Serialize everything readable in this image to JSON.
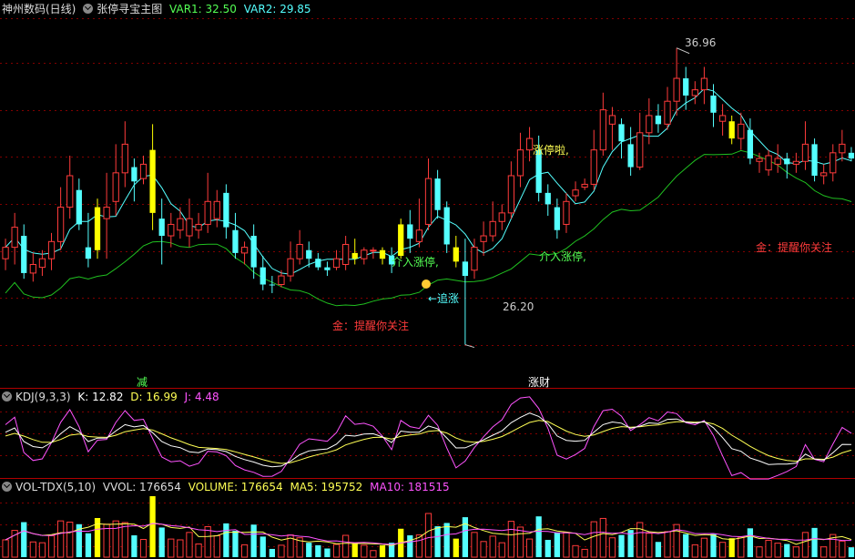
{
  "main": {
    "title": "神州数码(日线)",
    "indicator": "张停寻宝主图",
    "var1": "VAR1: 32.50",
    "var2": "VAR2: 29.85",
    "high_label": "36.96",
    "low_label": "26.20",
    "annotations": {
      "zhangtingla": "涨停啦,",
      "jieru1": "介入涨停,",
      "jieru2": "介入涨停,",
      "zhuizhang": "←追涨",
      "jin1": "金：提醒你关注",
      "jin2": "金：提醒你关注",
      "jian": "减",
      "zhangcai": "涨财"
    },
    "colors": {
      "up": "#ff3b3b",
      "down": "#54ffff",
      "signal": "#ffff00",
      "ma_fast": "#54ffff",
      "ma_slow": "#20c020"
    }
  },
  "kdj": {
    "label": "KDJ(9,3,3)",
    "k": "K: 12.82",
    "d": "D: 16.99",
    "j": "J: 4.48"
  },
  "vol": {
    "label": "VOL-TDX(5,10)",
    "vvol": "VVOL: 176654",
    "volume": "VOLUME: 176654",
    "ma5": "MA5: 195752",
    "ma10": "MA10: 181515"
  },
  "chart_data": [
    {
      "type": "candlestick",
      "title": "神州数码(日线)",
      "series": [
        {
          "name": "VAR1",
          "last": 32.5
        },
        {
          "name": "VAR2",
          "last": 29.85
        }
      ],
      "candles": [
        [
          29.6,
          30.0,
          29.2,
          30.3,
          "u"
        ],
        [
          30.0,
          30.7,
          29.4,
          31.2,
          "u"
        ],
        [
          30.4,
          29.1,
          28.9,
          30.8,
          "d"
        ],
        [
          29.1,
          29.4,
          28.8,
          29.8,
          "u"
        ],
        [
          29.3,
          29.6,
          29.0,
          29.9,
          "u"
        ],
        [
          29.6,
          30.2,
          29.2,
          30.5,
          "u"
        ],
        [
          30.2,
          31.4,
          29.9,
          32.1,
          "u"
        ],
        [
          31.4,
          32.5,
          31.0,
          33.2,
          "u"
        ],
        [
          32.0,
          30.8,
          30.6,
          32.4,
          "d"
        ],
        [
          30.0,
          29.6,
          29.3,
          31.2,
          "d"
        ],
        [
          29.9,
          31.4,
          29.6,
          31.7,
          "s"
        ],
        [
          31.4,
          31.0,
          29.6,
          32.6,
          "u"
        ],
        [
          31.6,
          32.6,
          31.1,
          33.6,
          "u"
        ],
        [
          32.6,
          33.6,
          32.1,
          34.4,
          "u"
        ],
        [
          32.8,
          32.3,
          31.6,
          33.1,
          "d"
        ],
        [
          32.4,
          32.9,
          32.2,
          33.2,
          "u"
        ],
        [
          33.4,
          31.2,
          30.6,
          34.3,
          "s"
        ],
        [
          31.0,
          30.4,
          29.4,
          31.7,
          "d"
        ],
        [
          30.4,
          30.8,
          30.0,
          31.2,
          "u"
        ],
        [
          30.6,
          31.0,
          30.3,
          31.4,
          "u"
        ],
        [
          31.0,
          30.4,
          30.0,
          31.7,
          "u"
        ],
        [
          30.6,
          30.8,
          30.3,
          31.2,
          "u"
        ],
        [
          30.8,
          31.6,
          30.5,
          32.6,
          "u"
        ],
        [
          31.6,
          31.0,
          30.7,
          32.0,
          "u"
        ],
        [
          31.9,
          30.7,
          30.3,
          32.2,
          "d"
        ],
        [
          30.6,
          29.8,
          29.6,
          31.2,
          "d"
        ],
        [
          30.0,
          29.8,
          29.4,
          30.2,
          "u"
        ],
        [
          30.4,
          29.3,
          28.9,
          30.8,
          "d"
        ],
        [
          29.3,
          28.7,
          28.5,
          29.7,
          "d"
        ],
        [
          28.7,
          28.7,
          28.4,
          29.0,
          "d"
        ],
        [
          28.7,
          29.0,
          28.6,
          29.2,
          "u"
        ],
        [
          29.0,
          29.6,
          28.8,
          30.2,
          "u"
        ],
        [
          29.6,
          30.1,
          29.4,
          30.6,
          "u"
        ],
        [
          29.9,
          29.6,
          29.3,
          30.2,
          "d"
        ],
        [
          29.6,
          29.3,
          29.2,
          29.8,
          "d"
        ],
        [
          29.2,
          29.3,
          29.0,
          29.5,
          "d"
        ],
        [
          29.3,
          29.6,
          29.2,
          29.9,
          "u"
        ],
        [
          29.4,
          30.1,
          29.2,
          30.4,
          "u"
        ],
        [
          29.8,
          29.6,
          29.4,
          30.3,
          "s"
        ],
        [
          29.6,
          29.9,
          29.4,
          30.0,
          "u"
        ],
        [
          29.9,
          29.9,
          29.6,
          30.0,
          "u"
        ],
        [
          29.9,
          29.6,
          29.4,
          30.0,
          "s"
        ],
        [
          29.7,
          29.4,
          29.1,
          30.0,
          "d"
        ],
        [
          29.7,
          30.8,
          29.6,
          31.0,
          "s"
        ],
        [
          30.8,
          30.3,
          29.8,
          31.3,
          "d"
        ],
        [
          30.2,
          30.6,
          30.0,
          31.7,
          "u"
        ],
        [
          30.8,
          32.4,
          30.6,
          33.1,
          "u"
        ],
        [
          32.4,
          31.3,
          31.0,
          32.7,
          "d"
        ],
        [
          31.4,
          30.1,
          29.8,
          31.6,
          "d"
        ],
        [
          30.0,
          29.5,
          29.3,
          30.4,
          "s"
        ],
        [
          29.5,
          29.0,
          26.6,
          30.3,
          "d"
        ],
        [
          29.2,
          30.0,
          28.9,
          30.3,
          "u"
        ],
        [
          30.2,
          30.4,
          29.7,
          30.9,
          "u"
        ],
        [
          30.4,
          30.9,
          30.2,
          31.6,
          "u"
        ],
        [
          30.9,
          31.2,
          30.6,
          31.5,
          "u"
        ],
        [
          31.2,
          32.5,
          31.0,
          33.0,
          "u"
        ],
        [
          32.5,
          33.4,
          32.1,
          34.0,
          "u"
        ],
        [
          33.4,
          33.8,
          33.0,
          34.2,
          "u"
        ],
        [
          33.4,
          31.9,
          31.6,
          33.9,
          "d"
        ],
        [
          31.9,
          31.5,
          31.1,
          32.2,
          "d"
        ],
        [
          31.4,
          30.6,
          30.3,
          31.7,
          "d"
        ],
        [
          30.8,
          31.6,
          30.5,
          31.9,
          "u"
        ],
        [
          31.8,
          32.0,
          31.6,
          32.3,
          "u"
        ],
        [
          32.1,
          32.2,
          32.0,
          32.4,
          "u"
        ],
        [
          32.2,
          33.4,
          32.0,
          34.1,
          "u"
        ],
        [
          33.4,
          34.8,
          33.2,
          35.4,
          "u"
        ],
        [
          34.6,
          34.3,
          33.4,
          34.9,
          "u"
        ],
        [
          34.3,
          33.7,
          33.1,
          34.5,
          "d"
        ],
        [
          33.6,
          32.8,
          32.5,
          34.2,
          "d"
        ],
        [
          32.8,
          34.0,
          32.7,
          34.7,
          "u"
        ],
        [
          34.0,
          34.6,
          33.6,
          35.2,
          "u"
        ],
        [
          34.6,
          34.3,
          34.0,
          35.0,
          "d"
        ],
        [
          34.3,
          35.1,
          34.1,
          35.6,
          "u"
        ],
        [
          35.1,
          35.9,
          34.6,
          36.96,
          "u"
        ],
        [
          35.9,
          35.3,
          34.8,
          36.3,
          "d"
        ],
        [
          35.3,
          35.5,
          35.0,
          35.8,
          "u"
        ],
        [
          35.5,
          35.9,
          35.0,
          36.3,
          "u"
        ],
        [
          35.3,
          34.7,
          34.2,
          35.7,
          "d"
        ],
        [
          34.6,
          34.4,
          33.9,
          35.0,
          "u"
        ],
        [
          34.4,
          33.8,
          33.6,
          34.6,
          "s"
        ],
        [
          33.8,
          34.3,
          33.4,
          34.7,
          "u"
        ],
        [
          34.1,
          33.1,
          32.9,
          34.5,
          "d"
        ],
        [
          33.1,
          33.0,
          32.6,
          33.3,
          "u"
        ],
        [
          33.2,
          32.7,
          32.5,
          33.4,
          "u"
        ],
        [
          32.9,
          33.1,
          32.6,
          33.6,
          "u"
        ],
        [
          33.1,
          32.9,
          32.4,
          33.3,
          "d"
        ],
        [
          33.0,
          32.9,
          32.6,
          33.3,
          "u"
        ],
        [
          33.0,
          33.6,
          32.7,
          34.4,
          "u"
        ],
        [
          33.6,
          32.5,
          32.3,
          33.8,
          "d"
        ],
        [
          32.5,
          32.6,
          32.2,
          32.9,
          "u"
        ],
        [
          32.6,
          33.3,
          32.3,
          33.6,
          "u"
        ],
        [
          33.3,
          33.6,
          33.0,
          34.1,
          "u"
        ],
        [
          33.3,
          33.1,
          33.0,
          33.5,
          "d"
        ]
      ],
      "annotations": [
        {
          "text": "36.96",
          "kind": "high"
        },
        {
          "text": "26.20",
          "kind": "low"
        }
      ],
      "grid": "horizontal dashed"
    },
    {
      "type": "line",
      "title": "KDJ(9,3,3)",
      "series": [
        {
          "name": "K",
          "last": 12.82
        },
        {
          "name": "D",
          "last": 16.99
        },
        {
          "name": "J",
          "last": 4.48
        }
      ]
    },
    {
      "type": "bar",
      "title": "VOL-TDX(5,10)",
      "series": [
        {
          "name": "VVOL",
          "last": 176654
        },
        {
          "name": "VOLUME",
          "last": 176654
        },
        {
          "name": "MA5",
          "last": 195752
        },
        {
          "name": "MA10",
          "last": 181515
        }
      ]
    }
  ]
}
